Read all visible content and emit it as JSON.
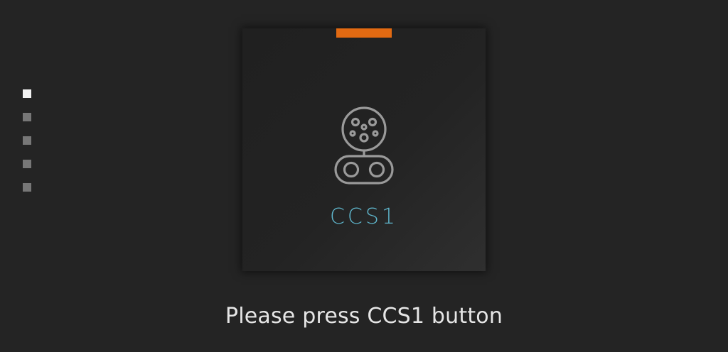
{
  "pager": {
    "count": 5,
    "active_index": 0
  },
  "card": {
    "icon": "ccs1-connector-icon",
    "label": "CCS1",
    "accent_color": "#e26a12",
    "label_color": "#5fb6cc"
  },
  "instruction": "Please press CCS1 button"
}
